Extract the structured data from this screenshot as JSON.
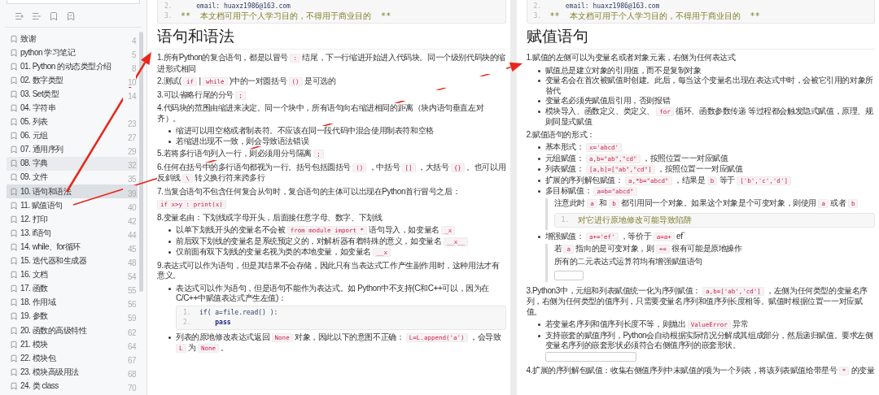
{
  "sidebar": {
    "items": [
      {
        "label": "致谢",
        "page": "4",
        "selected": false,
        "highlighted": false
      },
      {
        "label": "python 学习笔记",
        "page": "5",
        "selected": false,
        "highlighted": false
      },
      {
        "label": "01. Python 的动态类型介绍",
        "page": "8",
        "selected": false,
        "highlighted": false
      },
      {
        "label": "02. 数字类型",
        "page": "10",
        "selected": false,
        "highlighted": false
      },
      {
        "label": "03. Set类型",
        "page": "14",
        "selected": false,
        "highlighted": false
      },
      {
        "label": "04. 字符串",
        "selected": false,
        "highlighted": false
      },
      {
        "label": "05. 列表",
        "page": "23",
        "selected": false,
        "highlighted": false
      },
      {
        "label": "06. 元组",
        "page": "27",
        "selected": false,
        "highlighted": false
      },
      {
        "label": "07. 通用序列",
        "page": "29",
        "selected": false,
        "highlighted": false
      },
      {
        "label": "08. 字典",
        "page": "32",
        "selected": false,
        "highlighted": true
      },
      {
        "label": "09. 文件",
        "page": "35",
        "selected": false,
        "highlighted": false
      },
      {
        "label": "10. 语句和语法",
        "page": "39",
        "selected": true,
        "highlighted": false
      },
      {
        "label": "11. 赋值语句",
        "page": "40",
        "selected": false,
        "highlighted": false
      },
      {
        "label": "12. 打印",
        "page": "42",
        "selected": false,
        "highlighted": false
      },
      {
        "label": "13. if语句",
        "page": "44",
        "selected": false,
        "highlighted": false
      },
      {
        "label": "14. while、for循环",
        "page": "45",
        "selected": false,
        "highlighted": false
      },
      {
        "label": "15. 迭代器和生成器",
        "page": "48",
        "selected": false,
        "highlighted": false
      },
      {
        "label": "16. 文档",
        "page": "54",
        "selected": false,
        "highlighted": false
      },
      {
        "label": "17. 函数",
        "page": "55",
        "selected": false,
        "highlighted": false
      },
      {
        "label": "18. 作用域",
        "page": "56",
        "selected": false,
        "highlighted": false
      },
      {
        "label": "19. 参数",
        "page": "59",
        "selected": false,
        "highlighted": false
      },
      {
        "label": "20. 函数的高级特性",
        "page": "62",
        "selected": false,
        "highlighted": false
      },
      {
        "label": "21. 模块",
        "page": "64",
        "selected": false,
        "highlighted": false
      },
      {
        "label": "22. 模块包",
        "page": "67",
        "selected": false,
        "highlighted": false
      },
      {
        "label": "23. 模块高级用法",
        "page": "68",
        "selected": false,
        "highlighted": false
      },
      {
        "label": "24. 类 class",
        "page": "70",
        "selected": false,
        "highlighted": false
      }
    ]
  },
  "pages": [
    {
      "header_code": {
        "lines": [
          {
            "number": "2.",
            "kind": "code",
            "text": "    email: huaxz1986@163.com"
          },
          {
            "number": "3.",
            "kind": "comment",
            "text": "**  本文档可用于个人学习目的，不得用于商业目的  **"
          }
        ]
      },
      "heading": "语句和语法",
      "blocks": [
        {
          "kind": "para",
          "segments": [
            {
              "text": "1.所有Python的复合语句，都是以冒号 "
            },
            {
              "code": ":"
            },
            {
              "text": " 结尾，下一行缩进开始进入代码块。同一个级别代码块的缩进形式相同"
            }
          ]
        },
        {
          "kind": "para",
          "segments": [
            {
              "text": "2.测试( "
            },
            {
              "code": "if"
            },
            {
              "text": " | "
            },
            {
              "code": "while"
            },
            {
              "text": " )中的一对圆括号 "
            },
            {
              "code": "()"
            },
            {
              "text": " 是可选的"
            }
          ]
        },
        {
          "kind": "para",
          "segments": [
            {
              "text": "3.可以省略行尾的分号 "
            },
            {
              "code": ";"
            }
          ]
        },
        {
          "kind": "para",
          "segments": [
            {
              "text": "4.代码块的范围由缩进来决定。同一个块中，所有语句向右缩进相同的距离（块内语句垂直左对齐）。"
            }
          ]
        },
        {
          "kind": "bullets",
          "items": [
            {
              "segments": [
                {
                  "text": "缩进可以用空格或者制表符。不应该在同一段代码中混合使用制表符和空格"
                }
              ]
            },
            {
              "segments": [
                {
                  "text": "若缩进出现不一致，则会导致语法错误"
                }
              ]
            }
          ]
        },
        {
          "kind": "para",
          "segments": [
            {
              "text": "5.若将多行语句列入一行，则必须用分号隔离 "
            },
            {
              "code": ";"
            }
          ]
        },
        {
          "kind": "para",
          "segments": [
            {
              "text": "6.任何在括号中的多行语句都视为一行。括号包括圆括号 "
            },
            {
              "code": "()"
            },
            {
              "text": " ，中括号 "
            },
            {
              "code": "[]"
            },
            {
              "text": " ，大括号 "
            },
            {
              "code": "{}"
            },
            {
              "text": " 。也可以用反斜线 "
            },
            {
              "code": "\\"
            },
            {
              "text": " 转义换行符来跨多行"
            }
          ]
        },
        {
          "kind": "para",
          "segments": [
            {
              "text": "7.当复合语句不包含任何复合从句时，复合语句的主体可以出现在Python首行冒号之后："
            }
          ]
        },
        {
          "kind": "para",
          "segments": [
            {
              "code": "if x>y : print(x)"
            }
          ]
        },
        {
          "kind": "para",
          "segments": [
            {
              "text": "8.变量名由：下划线或字母开头，后面接任意字母、数字、下划线"
            }
          ]
        },
        {
          "kind": "bullets",
          "items": [
            {
              "segments": [
                {
                  "text": "以单下划线开头的变量名不会被 "
                },
                {
                  "code": "from module import *"
                },
                {
                  "text": " 语句导入，如变量名 "
                },
                {
                  "code": "_x"
                }
              ]
            },
            {
              "segments": [
                {
                  "text": "前后双下划线的变量名是系统预定义的，对解析器有着特殊的意义，如变量名 "
                },
                {
                  "code": "__x__"
                }
              ]
            },
            {
              "segments": [
                {
                  "text": "仅前面有双下划线的变量名视为类的本地变量，如变量名 "
                },
                {
                  "code": "__x"
                }
              ]
            }
          ]
        },
        {
          "kind": "para",
          "segments": [
            {
              "text": "9.表达式可以作为语句，但是其结果不会存储，因此只有当表达式工作产生副作用时，这种用法才有意义。"
            }
          ]
        },
        {
          "kind": "bullets",
          "items": [
            {
              "segments": [
                {
                  "text": "表达式可以作为语句，但是语句不能作为表达式。如 Python中不支持(C和C++可以，因为在C/C++中赋值表达式产生左值)："
                }
              ],
              "children": [
                {
                  "kind": "code",
                  "lines": [
                    {
                      "number": "1.",
                      "kind": "code",
                      "text": "if( a=file.read() ):"
                    },
                    {
                      "number": "2.",
                      "kind": "keyword",
                      "text": "    pass"
                    }
                  ]
                }
              ]
            },
            {
              "segments": [
                {
                  "text": "列表的原地修改表达式返回 "
                },
                {
                  "code": "None"
                },
                {
                  "text": " 对象，因此以下的意图不正确： "
                },
                {
                  "code": "L=L.append('a')"
                },
                {
                  "text": " ，会导致 "
                },
                {
                  "code": "L"
                },
                {
                  "text": " 为 "
                },
                {
                  "code": "None"
                },
                {
                  "text": " 。"
                }
              ]
            }
          ]
        }
      ]
    },
    {
      "header_code": {
        "lines": [
          {
            "number": "2.",
            "kind": "code",
            "text": "    email: huaxz1986@163.com"
          },
          {
            "number": "3.",
            "kind": "comment",
            "text": "**  本文档可用于个人学习目的，不得用于商业目的  **"
          }
        ]
      },
      "heading": "赋值语句",
      "blocks": [
        {
          "kind": "para",
          "segments": [
            {
              "text": "1.赋值的左侧可以为变量名或者对象元素，右侧为任何表达式"
            }
          ]
        },
        {
          "kind": "bullets",
          "items": [
            {
              "segments": [
                {
                  "text": "赋值总是建立对象的引用值，而不是复制对象"
                }
              ]
            },
            {
              "segments": [
                {
                  "text": "变量名会在首次被赋值时创建。此后，每当这个变量名出现在表达式中时，会被它引用的对象所替代"
                }
              ]
            },
            {
              "segments": [
                {
                  "text": "变量名必须先赋值后引用，否则报错"
                }
              ]
            },
            {
              "segments": [
                {
                  "text": "模块导入、函数定义、类定义、 "
                },
                {
                  "code": "for"
                },
                {
                  "text": " 循环、函数参数传递  等过程都会触发隐式赋值，原理、规则同显式赋值"
                }
              ]
            }
          ]
        },
        {
          "kind": "para",
          "segments": [
            {
              "text": "2.赋值语句的形式："
            }
          ]
        },
        {
          "kind": "bullets",
          "items": [
            {
              "segments": [
                {
                  "text": "基本形式： "
                },
                {
                  "code": "x='abcd'"
                }
              ]
            },
            {
              "segments": [
                {
                  "text": "元组赋值： "
                },
                {
                  "code": "a,b=\"ab\",\"cd\""
                },
                {
                  "text": " ，按照位置一一对应赋值"
                }
              ]
            },
            {
              "segments": [
                {
                  "text": "列表赋值： "
                },
                {
                  "code": "[a,b]=[\"ab\",\"cd\"]"
                },
                {
                  "text": " ，按照位置一一对应赋值"
                }
              ]
            },
            {
              "segments": [
                {
                  "text": "扩展的序列解包赋值： "
                },
                {
                  "code": "a,*b=\"abcd\""
                },
                {
                  "text": " ，结果是 "
                },
                {
                  "code": "b"
                },
                {
                  "text": " 等于 "
                },
                {
                  "code": "['b','c','d']"
                }
              ]
            },
            {
              "segments": [
                {
                  "text": "多目标赋值： "
                },
                {
                  "code": "a=b=\"abcd\""
                }
              ],
              "children": [
                {
                  "kind": "quote",
                  "blocks": [
                    {
                      "kind": "para",
                      "segments": [
                        {
                          "text": "注意此时 "
                        },
                        {
                          "code": "a"
                        },
                        {
                          "text": " 和 "
                        },
                        {
                          "code": "b"
                        },
                        {
                          "text": " 都引用同一个对象。如果这个对象是个可变对象，则使用 "
                        },
                        {
                          "code": "a"
                        },
                        {
                          "text": " 或者 "
                        },
                        {
                          "code": "b"
                        }
                      ]
                    },
                    {
                      "kind": "code",
                      "lines": [
                        {
                          "number": "1.",
                          "kind": "comment",
                          "text": "对它进行原地修改可能导致陷阱"
                        }
                      ]
                    }
                  ]
                }
              ]
            },
            {
              "segments": [
                {
                  "text": "增强赋值： "
                },
                {
                  "code": "a+='ef'"
                },
                {
                  "text": " ，等价于 "
                },
                {
                  "code": "a=a+"
                },
                {
                  "text": " ef`"
                }
              ],
              "children": [
                {
                  "kind": "quote",
                  "blocks": [
                    {
                      "kind": "para",
                      "segments": [
                        {
                          "text": "若 "
                        },
                        {
                          "code": "a"
                        },
                        {
                          "text": " 指向的是可变对象，则 "
                        },
                        {
                          "code": "+="
                        },
                        {
                          "text": " 很有可能是原地操作"
                        }
                      ]
                    },
                    {
                      "kind": "para",
                      "segments": [
                        {
                          "text": "所有的二元表达式运算符均有增强赋值语句"
                        }
                      ]
                    },
                    {
                      "kind": "empty"
                    }
                  ]
                }
              ]
            }
          ]
        },
        {
          "kind": "para",
          "segments": [
            {
              "text": "3.Python3中，元组和列表赋值统一化为序列赋值： "
            },
            {
              "code": "a,b=['ab','cd']"
            },
            {
              "text": " ，左侧为任何类型的变量名序列，右侧为任何类型的值序列，只需要变量名序列和值序列长度相等。赋值时根据位置一一对应赋值。"
            }
          ]
        },
        {
          "kind": "bullets",
          "items": [
            {
              "segments": [
                {
                  "text": "若变量名序列和值序列长度不等，则抛出 "
                },
                {
                  "code": "ValueError"
                },
                {
                  "text": " 异常"
                }
              ]
            },
            {
              "segments": [
                {
                  "text": "支持嵌套的赋值序列，Python会自动根据实际情况分解成其组成部分，然后递归赋值。要求左侧变量名序列的嵌套形状必须符合右侧值序列的嵌套形状。"
                }
              ],
              "children": [
                {
                  "kind": "empty",
                  "wide": true
                }
              ]
            }
          ]
        },
        {
          "kind": "para",
          "segments": [
            {
              "text": "4.扩展的序列解包赋值：收集右侧值序列中未赋值的项为一个列表，将该列表赋值给带星号 "
            },
            {
              "code": "*"
            },
            {
              "text": " 的变量"
            }
          ]
        }
      ]
    }
  ]
}
